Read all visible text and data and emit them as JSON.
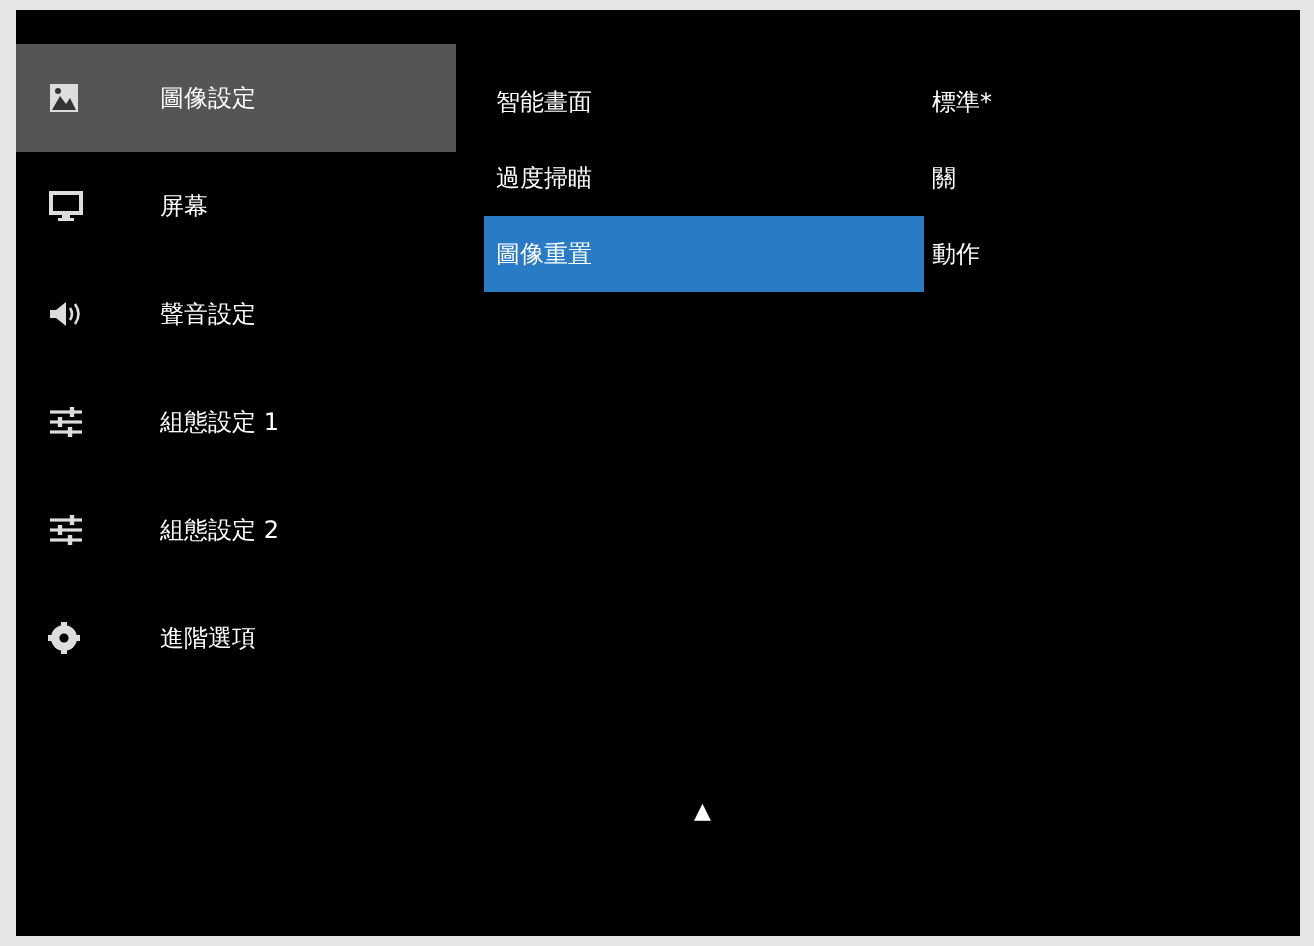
{
  "sidebar": {
    "items": [
      {
        "label": "圖像設定",
        "kind": "picture",
        "selected": true
      },
      {
        "label": "屏幕",
        "kind": "monitor",
        "selected": false
      },
      {
        "label": "聲音設定",
        "kind": "speaker",
        "selected": false
      },
      {
        "label": "組態設定 1",
        "kind": "sliders",
        "selected": false
      },
      {
        "label": "組態設定 2",
        "kind": "sliders",
        "selected": false
      },
      {
        "label": "進階選項",
        "kind": "gear",
        "selected": false
      }
    ]
  },
  "settings": [
    {
      "label": "智能畫面",
      "value": "標準*",
      "selected": false
    },
    {
      "label": "過度掃瞄",
      "value": "關",
      "selected": false
    },
    {
      "label": "圖像重置",
      "value": "動作",
      "selected": true
    }
  ],
  "scroll_up_arrow": "▲"
}
